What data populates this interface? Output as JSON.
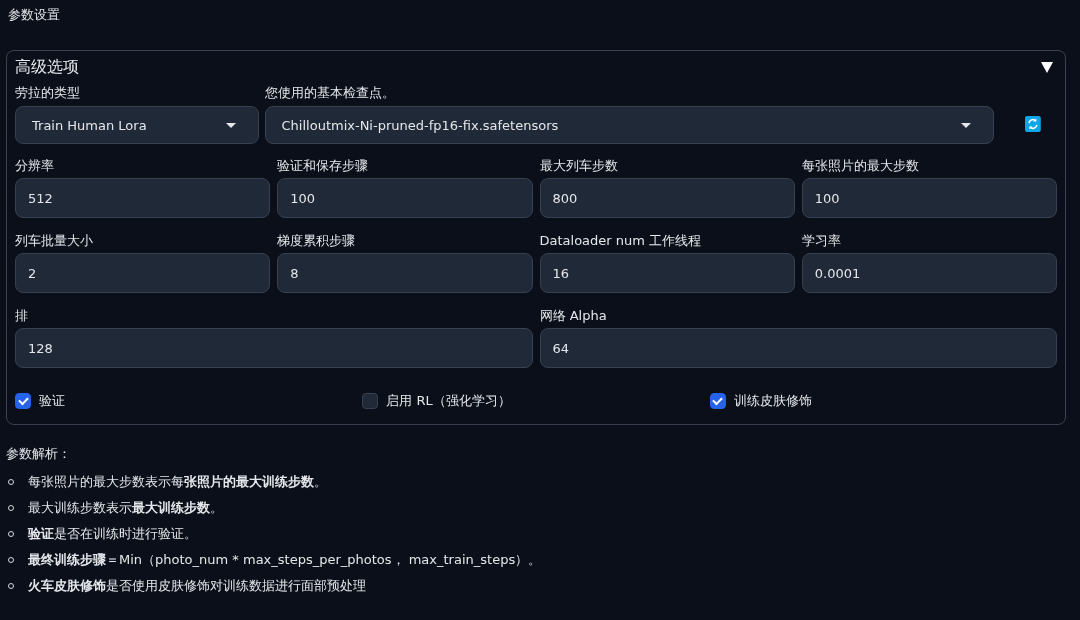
{
  "page_title": "参数设置",
  "panel": {
    "title": "高级选项",
    "expanded": true,
    "dropdowns": [
      {
        "label": "劳拉的类型",
        "value": "Train Human Lora"
      },
      {
        "label": "您使用的基本检查点。",
        "value": "Chilloutmix-Ni-pruned-fp16-fix.safetensors"
      }
    ],
    "field_rows": [
      [
        {
          "label": "分辨率",
          "value": "512"
        },
        {
          "label": "验证和保存步骤",
          "value": "100"
        },
        {
          "label": "最大列车步数",
          "value": "800"
        },
        {
          "label": "每张照片的最大步数",
          "value": "100"
        }
      ],
      [
        {
          "label": "列车批量大小",
          "value": "2"
        },
        {
          "label": "梯度累积步骤",
          "value": "8"
        },
        {
          "label": "Dataloader num 工作线程",
          "value": "16"
        },
        {
          "label": "学习率",
          "value": "0.0001"
        }
      ],
      [
        {
          "label": "排",
          "value": "128"
        },
        {
          "label": "网络 Alpha",
          "value": "64"
        }
      ]
    ],
    "checkboxes": [
      {
        "label": "验证",
        "checked": true
      },
      {
        "label": "启用 RL（强化学习）",
        "checked": false
      },
      {
        "label": "训练皮肤修饰",
        "checked": true
      }
    ]
  },
  "notes": {
    "heading": "参数解析：",
    "items": [
      "每张照片的最大步数表示每**张照片的最大训练步数**。",
      "最大训练步数表示**最大训练步数**。",
      "**验证**是否在训练时进行验证。",
      "**最终训练步骤**＝Min（photo_num * max_steps_per_photos， max_train_steps）。",
      "**火车皮肤修饰**是否使用皮肤修饰对训练数据进行面部预处理"
    ]
  }
}
